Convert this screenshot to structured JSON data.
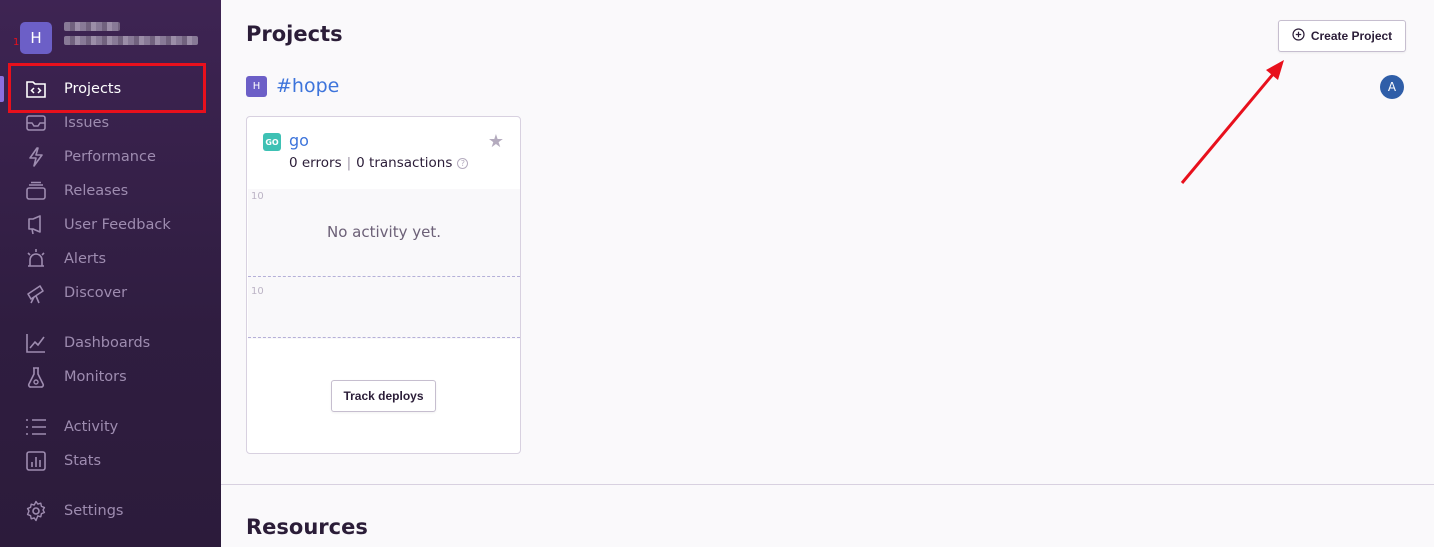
{
  "sidebar": {
    "org_initial": "H",
    "items": [
      {
        "label": "Projects",
        "icon": "folder-code-icon",
        "active": true
      },
      {
        "label": "Issues",
        "icon": "inbox-icon"
      },
      {
        "label": "Performance",
        "icon": "lightning-icon"
      },
      {
        "label": "Releases",
        "icon": "stack-icon"
      },
      {
        "label": "User Feedback",
        "icon": "megaphone-icon"
      },
      {
        "label": "Alerts",
        "icon": "siren-icon"
      },
      {
        "label": "Discover",
        "icon": "telescope-icon"
      },
      {
        "label": "Dashboards",
        "icon": "graph-icon"
      },
      {
        "label": "Monitors",
        "icon": "flask-icon"
      },
      {
        "label": "Activity",
        "icon": "list-icon"
      },
      {
        "label": "Stats",
        "icon": "bar-chart-icon"
      },
      {
        "label": "Settings",
        "icon": "gear-icon"
      }
    ],
    "annotation_number": "1"
  },
  "main": {
    "title": "Projects",
    "create_button": "Create Project",
    "team": {
      "initial": "H",
      "name": "#hope"
    },
    "member_initial": "A",
    "project": {
      "name": "go",
      "platform_icon": "go-icon",
      "errors": "0 errors",
      "transactions": "0 transactions",
      "chart_tick_top": "10",
      "chart_tick_bottom": "10",
      "empty_message": "No activity yet.",
      "deploy_button": "Track deploys"
    },
    "resources_title": "Resources"
  },
  "colors": {
    "sidebar_bg": "#3e2453",
    "accent": "#6c5fc7",
    "link": "#3d74db",
    "annotation_red": "#e8101c"
  }
}
